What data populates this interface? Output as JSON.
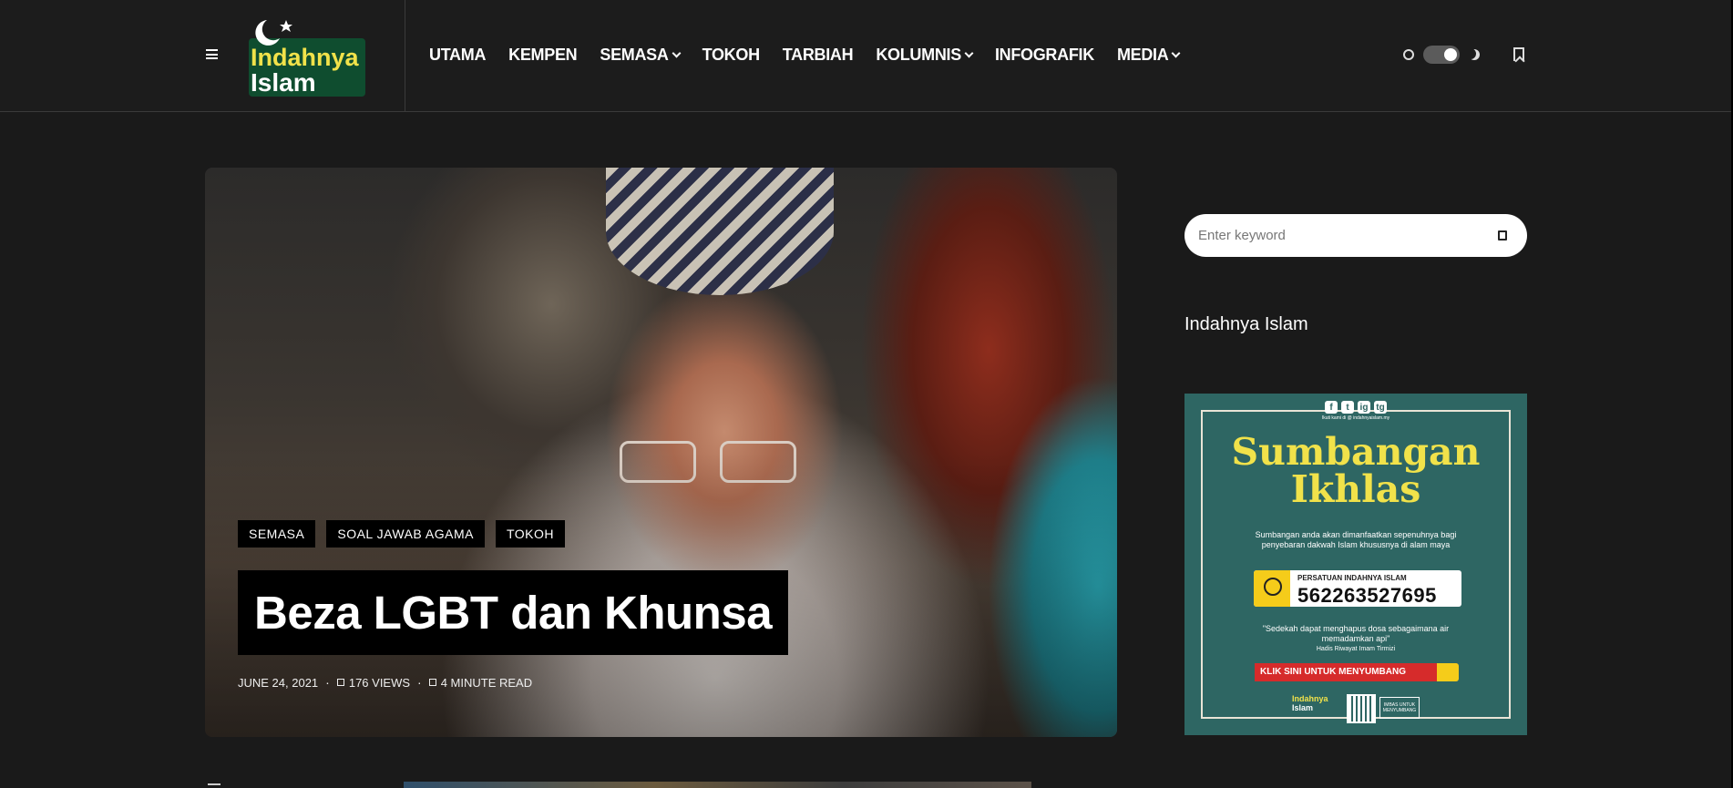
{
  "nav": {
    "items": [
      {
        "label": "UTAMA",
        "has_dropdown": false
      },
      {
        "label": "KEMPEN",
        "has_dropdown": false
      },
      {
        "label": "SEMASA",
        "has_dropdown": true
      },
      {
        "label": "TOKOH",
        "has_dropdown": false
      },
      {
        "label": "TARBIAH",
        "has_dropdown": false
      },
      {
        "label": "KOLUMNIS",
        "has_dropdown": true
      },
      {
        "label": "INFOGRAFIK",
        "has_dropdown": false
      },
      {
        "label": "MEDIA",
        "has_dropdown": true
      }
    ]
  },
  "logo": {
    "line1": "Indahnya",
    "line2": "Islam"
  },
  "theme": {
    "mode": "dark",
    "toggle_on": true
  },
  "hero": {
    "categories": [
      "SEMASA",
      "SOAL JAWAB AGAMA",
      "TOKOH"
    ],
    "title": "Beza LGBT dan Khunsa",
    "date": "JUNE 24, 2021",
    "views": "176 VIEWS",
    "read_time": "4 MINUTE READ"
  },
  "sidebar": {
    "search_placeholder": "Enter keyword",
    "widget_title": "Indahnya Islam",
    "banner": {
      "social": [
        "f",
        "t",
        "ig",
        "tg"
      ],
      "handle": "Ikuti kami di @ indahnyaislam.my",
      "heading_line1": "Sumbangan",
      "heading_line2": "Ikhlas",
      "description": "Sumbangan anda akan dimanfaatkan sepenuhnya bagi penyebaran dakwah Islam khususnya di alam maya",
      "account_name": "PERSATUAN INDAHNYA ISLAM",
      "account_number": "562263527695",
      "quote": "\"Sedekah dapat menghapus dosa sebagaimana air memadamkan api\"",
      "hadith": "Hadis Riwayat Imam Tirmizi",
      "cta": "KLIK SINI UNTUK MENYUMBANG",
      "footer_logo_line1": "Indahnya",
      "footer_logo_line2": "Islam",
      "scan_text": "IMBAS UNTUK MENYUMBANG"
    }
  },
  "colors": {
    "background": "#1a1a1a",
    "header": "#1c1c1c",
    "logo_yellow": "#f1e24a",
    "logo_green": "#0f4d2f",
    "banner_bg": "#2e6663",
    "banner_heading": "#f1e24a",
    "cta_red": "#d62b2b"
  }
}
